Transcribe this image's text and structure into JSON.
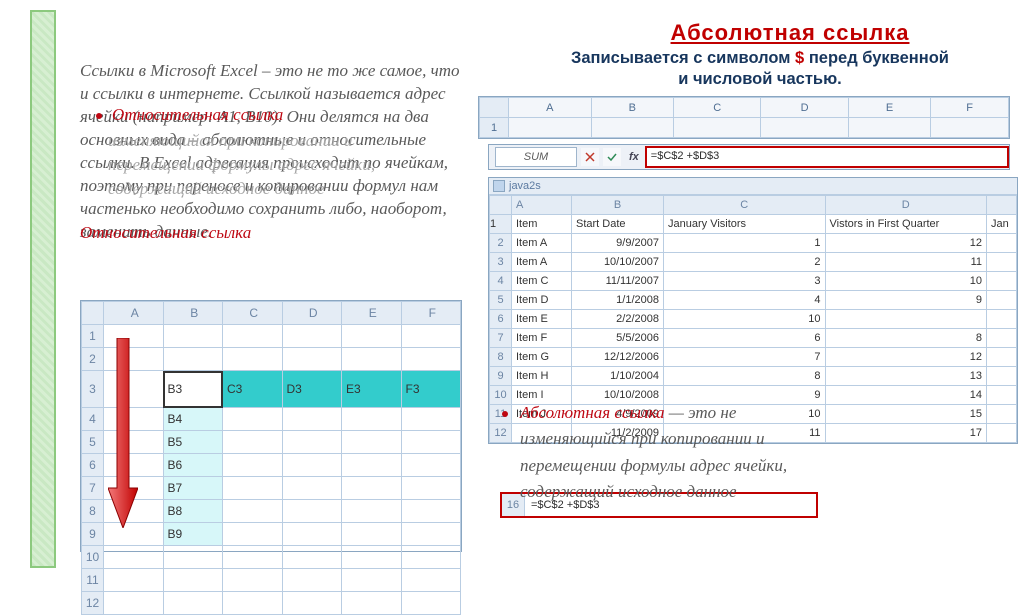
{
  "stripe": {},
  "main_paragraph": "Ссылки в Microsoft Excel – это не то же самое, что и ссылки в интернете. Ссылкой называется адрес ячейки (например: А1, В10). Они делятся на два основных вида – абсолютные и относительные ссылки. В Excel адресация происходит по ячейкам, поэтому при переносе и копировании формул нам частенько необходимо сохранить либо, наоборот, заменить данные.",
  "relative_overlay": {
    "title": "Относительная ссылка",
    "line1": "изменяющийся при копировании и",
    "line2": "перемещении формулы адрес ячейки,",
    "line3": "содержащий исходное данное",
    "title2": "Относительная ссылка"
  },
  "abs_title": "Абсолютная  ссылка",
  "abs_subtitle_before": "Записывается  с  символом ",
  "abs_subtitle_dollar": "$",
  "abs_subtitle_after1": " перед  буквенной",
  "abs_subtitle_after2": "и  числовой  частью.",
  "wide_excel": {
    "cols": [
      "A",
      "B",
      "C",
      "D",
      "E",
      "F"
    ]
  },
  "fx": {
    "name_box": "SUM",
    "formula": "=$C$2 +$D$3"
  },
  "narrow_excel": {
    "title": "java2s",
    "cols": [
      "A",
      "B",
      "C",
      "D"
    ],
    "header": [
      "Item",
      "Start Date",
      "January Visitors",
      "Vistors in First Quarter",
      "Jan"
    ],
    "rows": [
      {
        "n": "2",
        "a": "Item A",
        "b": "9/9/2007",
        "c": "1",
        "d": "12"
      },
      {
        "n": "3",
        "a": "Item A",
        "b": "10/10/2007",
        "c": "2",
        "d": "11"
      },
      {
        "n": "4",
        "a": "Item C",
        "b": "11/11/2007",
        "c": "3",
        "d": "10"
      },
      {
        "n": "5",
        "a": "Item D",
        "b": "1/1/2008",
        "c": "4",
        "d": "9"
      },
      {
        "n": "6",
        "a": "Item E",
        "b": "2/2/2008",
        "c": "10",
        "d": ""
      },
      {
        "n": "7",
        "a": "Item F",
        "b": "5/5/2006",
        "c": "6",
        "d": "8"
      },
      {
        "n": "8",
        "a": "Item G",
        "b": "12/12/2006",
        "c": "7",
        "d": "12"
      },
      {
        "n": "9",
        "a": "Item H",
        "b": "1/10/2004",
        "c": "8",
        "d": "13"
      },
      {
        "n": "10",
        "a": "Item I",
        "b": "10/10/2008",
        "c": "9",
        "d": "14"
      },
      {
        "n": "11",
        "a": "Item J",
        "b": "4/9/2009",
        "c": "10",
        "d": "15"
      },
      {
        "n": "12",
        "a": "",
        "b": "11/2/2009",
        "c": "11",
        "d": "17"
      }
    ]
  },
  "fx_result": {
    "row": "16",
    "formula": "=$C$2 +$D$3"
  },
  "abs_para": {
    "red": "Абсолютная ссылка",
    "rest1": " — это не",
    "rest2": "изменяющийся при копировании и",
    "rest3": "перемещении формулы адрес ячейки,",
    "rest4": "содержащий исходное данное"
  },
  "left_excel": {
    "cols": [
      "",
      "A",
      "B",
      "C",
      "D",
      "E",
      "F"
    ],
    "row3": [
      "B3",
      "C3",
      "D3",
      "E3",
      "F3"
    ],
    "bcol": [
      "B4",
      "B5",
      "B6",
      "B7",
      "B8",
      "B9"
    ]
  }
}
